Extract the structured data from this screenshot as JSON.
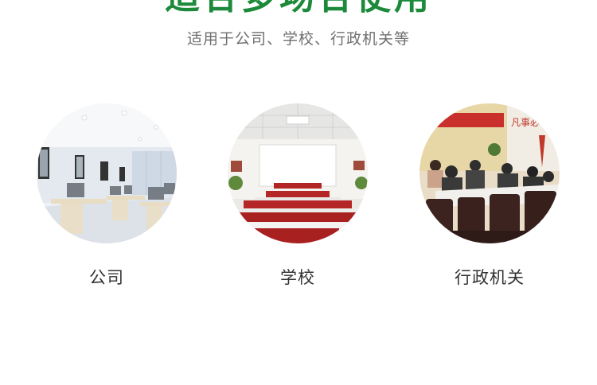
{
  "header": {
    "title": "适合多场合使用",
    "subtitle": "适用于公司、学校、行政机关等"
  },
  "venues": [
    {
      "label": "公司",
      "image": "office-photo"
    },
    {
      "label": "学校",
      "image": "classroom-photo"
    },
    {
      "label": "行政机关",
      "image": "meeting-room-photo"
    }
  ],
  "banner_text": "凡事必",
  "colors": {
    "title": "#1c8a3a",
    "subtitle": "#6f6f6f",
    "label": "#333333"
  }
}
